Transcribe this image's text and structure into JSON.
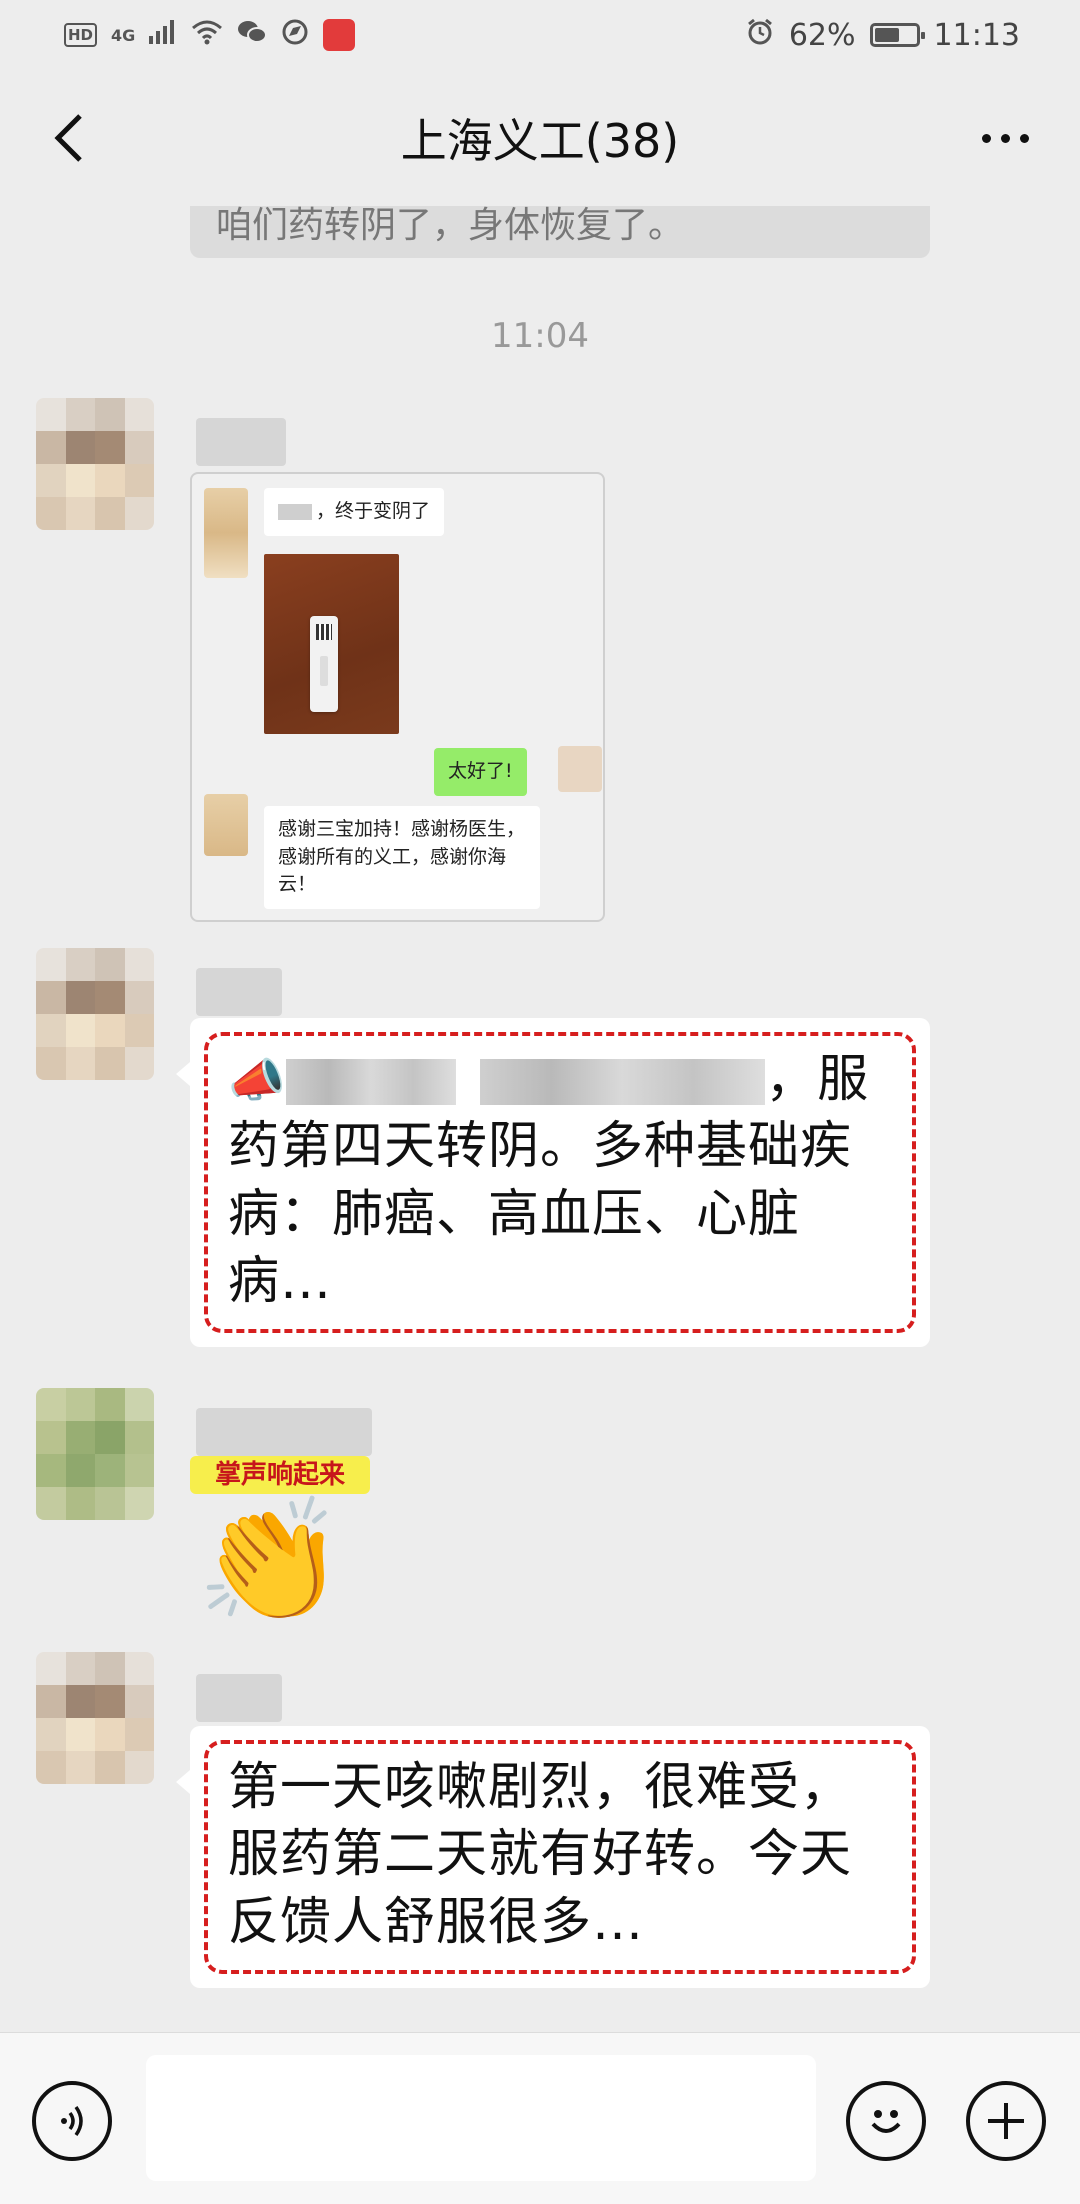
{
  "status_bar": {
    "hd": "HD",
    "network": "4G",
    "battery_percent": "62%",
    "battery_level": 0.62,
    "time": "11:13"
  },
  "nav": {
    "title": "上海义工(38)"
  },
  "chat": {
    "cut_message": "咱们药转阴了，身体恢复了。",
    "timestamp": "11:04",
    "forwarded": {
      "msg1_suffix": "，终于变阴了",
      "msg2": "太好了!",
      "msg3": "感谢三宝加持！感谢杨医生，感谢所有的义工，感谢你海云！"
    },
    "message1": {
      "horn": "📣",
      "text_a": "，服",
      "text_b": "药第四天转阴。多种基础疾",
      "text_c": "病：肺癌、高血压、心脏",
      "text_d": "病…"
    },
    "sticker": {
      "caption": "掌声响起来",
      "hands": "👏"
    },
    "message2": {
      "line1": "第一天咳嗽剧烈，很难受，",
      "line2": "服药第二天就有好转。今天",
      "line3": "反馈人舒服很多…"
    }
  },
  "input": {
    "placeholder": ""
  },
  "icons": {
    "back": "chevron-left-icon",
    "more": "more-dots-icon",
    "voice": "voice-icon",
    "emoji": "emoji-icon",
    "plus": "plus-icon"
  }
}
